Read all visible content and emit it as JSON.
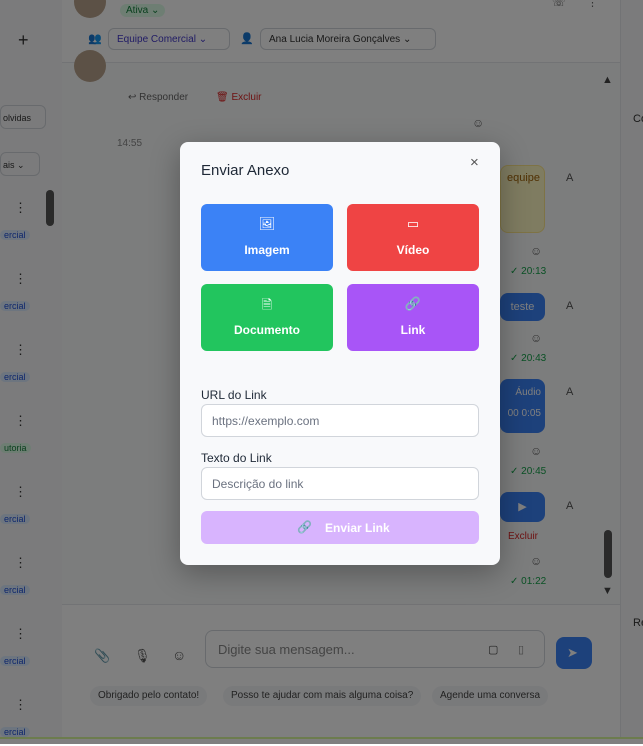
{
  "background": {
    "header": {
      "status": "Ativa",
      "team": "Equipe Comercial",
      "agent": "Ana Lucia Moreira Gonçalves"
    },
    "message_actions": {
      "reply": "Responder",
      "delete": "Excluir"
    },
    "time_left": "14:55",
    "left_items": [
      {
        "tag": "olvidas",
        "color": "blue"
      },
      {
        "tag": "ais",
        "color": "none"
      },
      {
        "tag": "ercial",
        "color": "blue"
      },
      {
        "tag": "ercial",
        "color": "blue"
      },
      {
        "tag": "ercial",
        "color": "blue"
      },
      {
        "tag": "utoria",
        "color": "green"
      },
      {
        "tag": "ercial",
        "color": "blue"
      },
      {
        "tag": "ercial",
        "color": "blue"
      },
      {
        "tag": "ercial",
        "color": "blue"
      },
      {
        "tag": "ercial",
        "color": "blue"
      }
    ],
    "messages": [
      {
        "text": "equipe",
        "time": "20:13"
      },
      {
        "text": "teste",
        "time": "20:43"
      },
      {
        "text": "Áudio",
        "sub": "00 0:05",
        "time": "20:45"
      },
      {
        "text": "▶",
        "extra": "Excluir",
        "time": "01:22"
      }
    ],
    "composer_placeholder": "Digite sua mensagem...",
    "quick_replies": [
      "Obrigado pelo contato!",
      "Posso te ajudar com mais alguma coisa?",
      "Agende uma conversa"
    ],
    "avatar_initial": "A",
    "right_labels": {
      "top": "Co",
      "bottom": "Re"
    }
  },
  "modal": {
    "title": "Enviar Anexo",
    "close_icon": "×",
    "options": [
      {
        "label": "Imagem",
        "icon": "image-icon",
        "glyph": "🖼",
        "color": "#3b82f6"
      },
      {
        "label": "Vídeo",
        "icon": "video-icon",
        "glyph": "▭",
        "color": "#ef4444"
      },
      {
        "label": "Documento",
        "icon": "document-icon",
        "glyph": "🗎",
        "color": "#22c55e"
      },
      {
        "label": "Link",
        "icon": "link-icon",
        "glyph": "🔗",
        "color": "#a855f7"
      }
    ],
    "url_label": "URL do Link",
    "url_placeholder": "https://exemplo.com",
    "text_label": "Texto do Link",
    "text_placeholder": "Descrição do link",
    "submit_label": "Enviar Link",
    "submit_icon": "🔗"
  }
}
